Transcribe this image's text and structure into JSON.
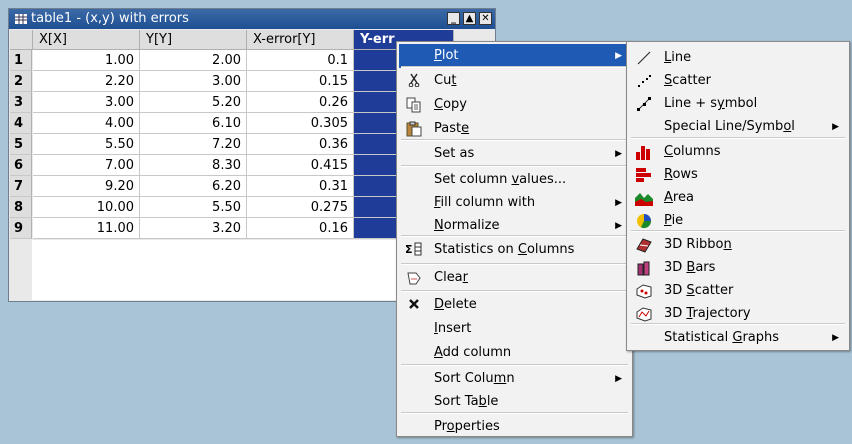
{
  "window": {
    "title": "table1 - (x,y) with errors",
    "buttons": [
      "_",
      "▲",
      "✕"
    ]
  },
  "table": {
    "columns": [
      "X[X]",
      "Y[Y]",
      "X-error[Y]",
      "Y-err"
    ],
    "row_numbers": [
      "1",
      "2",
      "3",
      "4",
      "5",
      "6",
      "7",
      "8",
      "9"
    ],
    "rows": [
      [
        "1.00",
        "2.00",
        "0.1",
        ""
      ],
      [
        "2.20",
        "3.00",
        "0.15",
        ""
      ],
      [
        "3.00",
        "5.20",
        "0.26",
        ""
      ],
      [
        "4.00",
        "6.10",
        "0.305",
        ""
      ],
      [
        "5.50",
        "7.20",
        "0.36",
        ""
      ],
      [
        "7.00",
        "8.30",
        "0.415",
        ""
      ],
      [
        "9.20",
        "6.20",
        "0.31",
        ""
      ],
      [
        "10.00",
        "5.50",
        "0.275",
        ""
      ],
      [
        "11.00",
        "3.20",
        "0.16",
        ""
      ]
    ]
  },
  "context_menu": {
    "items": [
      {
        "label": "Plot",
        "ul": "P",
        "icon": "",
        "submenu": true
      },
      {
        "label": "Cut",
        "ul": "t",
        "icon": "scissors-icon"
      },
      {
        "label": "Copy",
        "ul": "C",
        "icon": "copy-icon"
      },
      {
        "label": "Paste",
        "ul": "e",
        "icon": "paste-icon"
      },
      {
        "label": "Set as",
        "submenu": true
      },
      {
        "label": "Set column values...",
        "ul": "v"
      },
      {
        "label": "Fill column with",
        "ul": "F",
        "submenu": true
      },
      {
        "label": "Normalize",
        "ul": "N",
        "submenu": true
      },
      {
        "label": "Statistics on Columns",
        "ul": "C",
        "icon": "sigma-icon"
      },
      {
        "label": "Clear",
        "ul": "r",
        "icon": "eraser-icon"
      },
      {
        "label": "Delete",
        "ul": "D",
        "icon": "delete-x-icon"
      },
      {
        "label": "Insert",
        "ul": "I"
      },
      {
        "label": "Add column",
        "ul": "A"
      },
      {
        "label": "Sort Column",
        "ul": "m",
        "submenu": true
      },
      {
        "label": "Sort Table",
        "ul": "b"
      },
      {
        "label": "Properties",
        "ul": "o"
      }
    ]
  },
  "plot_submenu": {
    "items": [
      {
        "label": "Line",
        "ul": "L",
        "icon": "line-plot-icon"
      },
      {
        "label": "Scatter",
        "ul": "S",
        "icon": "scatter-plot-icon"
      },
      {
        "label": "Line + symbol",
        "ul": "y",
        "icon": "line-symbol-icon"
      },
      {
        "label": "Special Line/Symbol",
        "ul": "o",
        "submenu": true
      },
      {
        "label": "Columns",
        "ul": "C",
        "icon": "columns-chart-icon"
      },
      {
        "label": "Rows",
        "ul": "R",
        "icon": "rows-chart-icon"
      },
      {
        "label": "Area",
        "ul": "A",
        "icon": "area-chart-icon"
      },
      {
        "label": "Pie",
        "ul": "P",
        "icon": "pie-chart-icon"
      },
      {
        "label": "3D Ribbon",
        "ul": "n",
        "icon": "3d-ribbon-icon"
      },
      {
        "label": "3D Bars",
        "ul": "B",
        "icon": "3d-bars-icon"
      },
      {
        "label": "3D Scatter",
        "ul": "S",
        "icon": "3d-scatter-icon"
      },
      {
        "label": "3D Trajectory",
        "ul": "T",
        "icon": "3d-trajectory-icon"
      },
      {
        "label": "Statistical Graphs",
        "ul": "G",
        "submenu": true
      }
    ]
  }
}
